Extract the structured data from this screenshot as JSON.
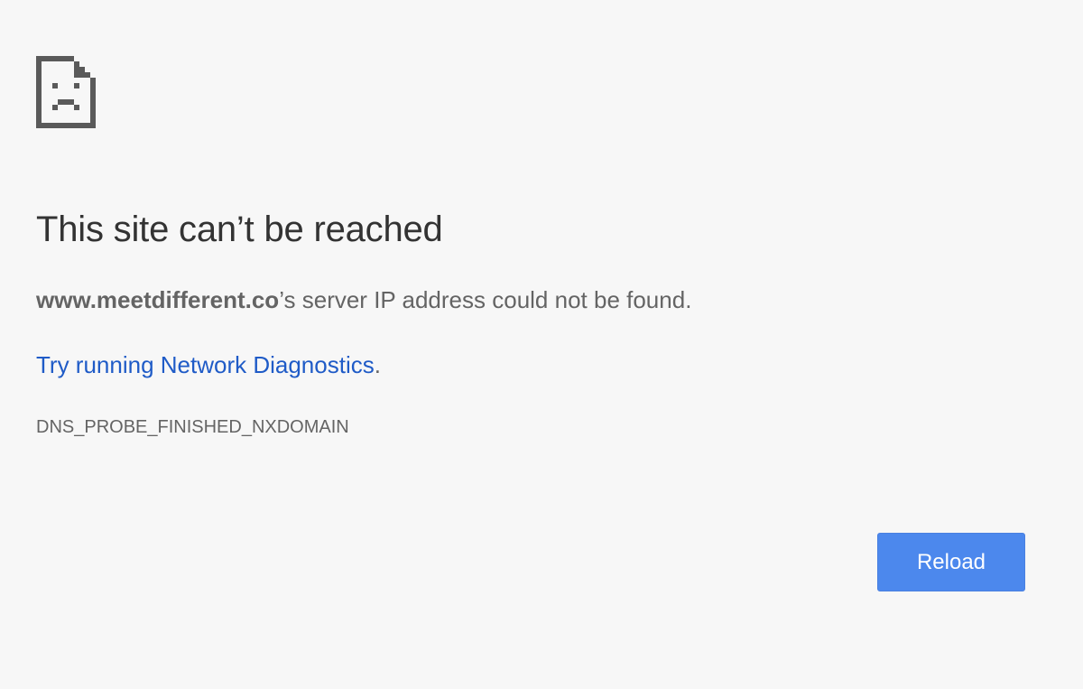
{
  "icon": "sad-file-icon",
  "heading": "This site can’t be reached",
  "summary": {
    "domain": "www.meetdifferent.co",
    "rest": "’s server IP address could not be found."
  },
  "suggestion": {
    "link_text": "Try running Network Diagnostics",
    "trailing": "."
  },
  "error_code": "DNS_PROBE_FINISHED_NXDOMAIN",
  "reload_button": {
    "label": "Reload"
  },
  "colors": {
    "background": "#f7f7f7",
    "heading": "#333333",
    "body_text": "#646464",
    "link": "#1f5bc7",
    "button": "#4c88ed",
    "icon": "#5a5a5a"
  }
}
